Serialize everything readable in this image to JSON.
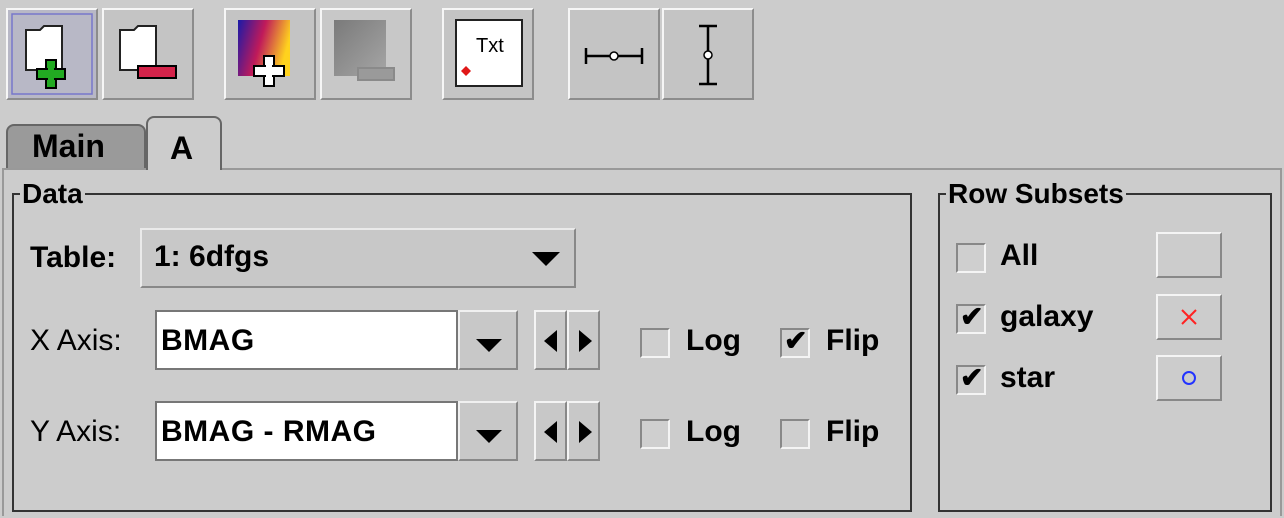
{
  "toolbar": {
    "buttons": [
      {
        "name": "add-table-layer",
        "icon": "folder-add-icon"
      },
      {
        "name": "remove-table-layer",
        "icon": "folder-remove-icon"
      },
      {
        "name": "add-colormap",
        "icon": "colormap-add-icon"
      },
      {
        "name": "remove-colormap",
        "icon": "colormap-remove-icon"
      },
      {
        "name": "add-text-label",
        "icon": "text-label-icon",
        "text": "Txt"
      },
      {
        "name": "horizontal-error-bars",
        "icon": "h-errorbar-icon"
      },
      {
        "name": "vertical-error-bars",
        "icon": "v-errorbar-icon"
      }
    ]
  },
  "tabs": [
    {
      "label": "Main",
      "selected": false
    },
    {
      "label": "A",
      "selected": true
    }
  ],
  "data_group": {
    "title": "Data",
    "table_label": "Table:",
    "table_value": "1: 6dfgs",
    "x_axis": {
      "label": "X Axis:",
      "value": "BMAG",
      "log_label": "Log",
      "log": false,
      "flip_label": "Flip",
      "flip": true
    },
    "y_axis": {
      "label": "Y Axis:",
      "value": "BMAG - RMAG",
      "log_label": "Log",
      "log": false,
      "flip_label": "Flip",
      "flip": false
    }
  },
  "subsets_group": {
    "title": "Row Subsets",
    "items": [
      {
        "label": "All",
        "checked": false,
        "marker": "none"
      },
      {
        "label": "galaxy",
        "checked": true,
        "marker": "cross",
        "color": "#ff2222"
      },
      {
        "label": "star",
        "checked": true,
        "marker": "circle",
        "color": "#2233ff"
      }
    ]
  },
  "check_mark": "✔"
}
